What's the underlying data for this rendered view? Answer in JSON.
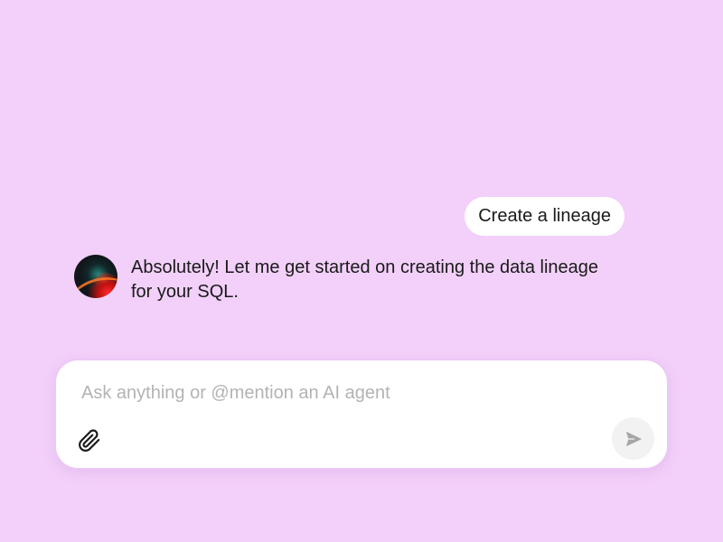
{
  "conversation": {
    "user_message": "Create a lineage",
    "assistant_message": "Absolutely! Let me get started on creating the data lineage for your SQL.",
    "assistant_avatar_icon": "assistant-avatar"
  },
  "composer": {
    "placeholder": "Ask anything or @mention an AI agent",
    "value": "",
    "attach_icon": "paperclip-icon",
    "send_icon": "send-icon"
  },
  "colors": {
    "background": "#f2d0f9",
    "bubble": "#ffffff",
    "placeholder": "#b3b3b3",
    "send_button_bg": "#f2f2f2",
    "send_icon": "#a6a6a6"
  }
}
